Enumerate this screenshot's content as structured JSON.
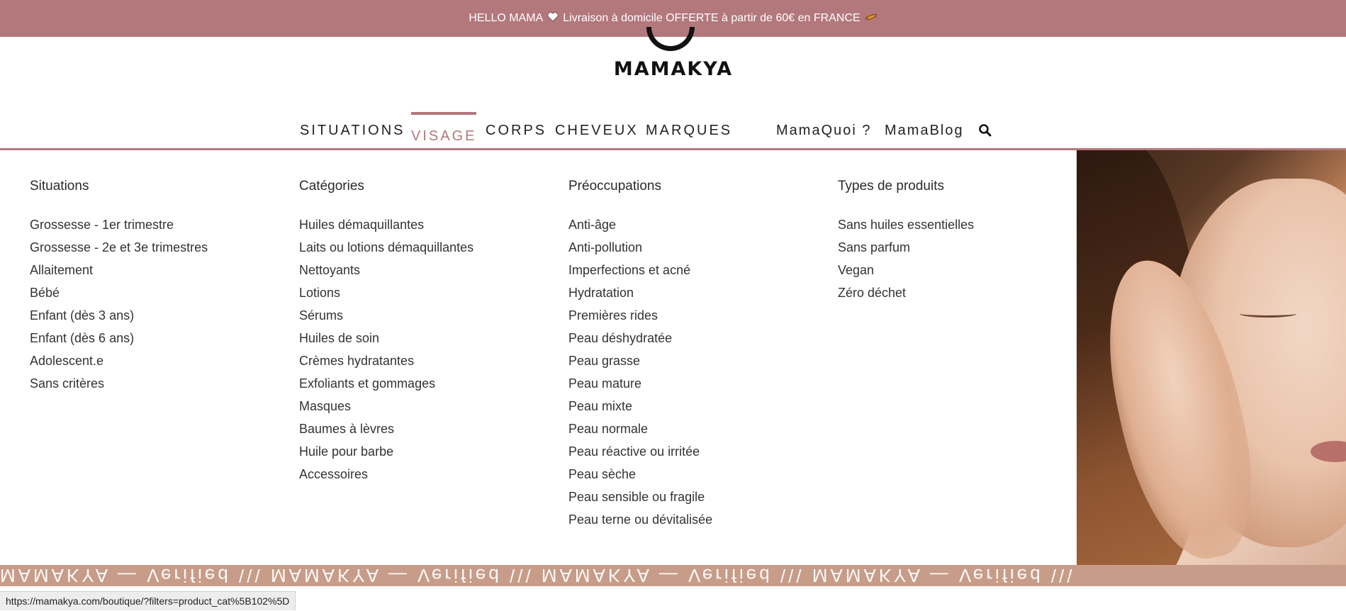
{
  "announcement": {
    "text_before": "HELLO MAMA",
    "heart_icon": "heart-icon",
    "text_after": "Livraison à domicile OFFERTE à partir de 60€ en FRANCE",
    "planet_icon": "planet-icon"
  },
  "logo": {
    "text": "MAMAKYA"
  },
  "nav": {
    "items": [
      "SITUATIONS",
      "VISAGE",
      "CORPS",
      "CHEVEUX",
      "MARQUES"
    ],
    "active": "VISAGE",
    "secondary": [
      "MamaQuoi ?",
      "MamaBlog"
    ],
    "search_icon": "search-icon"
  },
  "mega_menu": {
    "columns": [
      {
        "title": "Situations",
        "items": [
          "Grossesse - 1er trimestre",
          "Grossesse - 2e et 3e trimestres",
          "Allaitement",
          "Bébé",
          "Enfant (dès 3 ans)",
          "Enfant (dès 6 ans)",
          "Adolescent.e",
          "Sans critères"
        ]
      },
      {
        "title": "Catégories",
        "items": [
          "Huiles démaquillantes",
          "Laits ou lotions démaquillantes",
          "Nettoyants",
          "Lotions",
          "Sérums",
          "Huiles de soin",
          "Crèmes hydratantes",
          "Exfoliants et gommages",
          "Masques",
          "Baumes à lèvres",
          "Huile pour barbe",
          "Accessoires"
        ]
      },
      {
        "title": "Préoccupations",
        "items": [
          "Anti-âge",
          "Anti-pollution",
          "Imperfections et acné",
          "Hydratation",
          "Premières rides",
          "Peau déshydratée",
          "Peau grasse",
          "Peau mature",
          "Peau mixte",
          "Peau normale",
          "Peau réactive ou irritée",
          "Peau sèche",
          "Peau sensible ou fragile",
          "Peau terne ou dévitalisée"
        ]
      },
      {
        "title": "Types de produits",
        "items": [
          "Sans huiles essentielles",
          "Sans parfum",
          "Vegan",
          "Zéro déchet"
        ]
      }
    ]
  },
  "banner": {
    "text": "MAMAKYA — Verified \\\\\\ MAMAKYA — Verified \\\\\\ MAMAKYA — Verified \\\\\\ MAMAKYA — Verified \\\\\\"
  },
  "status_bar": {
    "url": "https://mamakya.com/boutique/?filters=product_cat%5B102%5D"
  },
  "colors": {
    "accent": "#b3787c",
    "banner": "#c79c88"
  }
}
